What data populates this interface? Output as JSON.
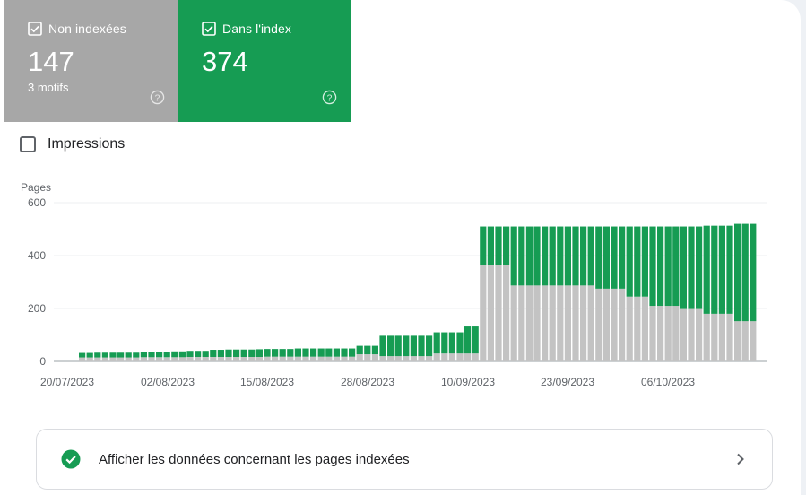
{
  "cards": [
    {
      "label": "Non indexées",
      "value": "147",
      "sub": "3 motifs",
      "color": "#a7a7a7"
    },
    {
      "label": "Dans l'index",
      "value": "374",
      "color": "#169c53"
    }
  ],
  "impressions": {
    "label": "Impressions",
    "checked": false
  },
  "link_row": {
    "label": "Afficher les données concernant les pages indexées"
  },
  "icons": {
    "card_check": "check-box-icon",
    "help": "help-circle-icon",
    "row_status": "check-circle-icon",
    "row_chevron": "chevron-right-icon"
  },
  "colors": {
    "indexed": "#169c53",
    "not_indexed": "#c3c3c3"
  },
  "chart_data": {
    "type": "bar",
    "stacked": true,
    "ylabel": "Pages",
    "ylim": [
      0,
      600
    ],
    "yticks": [
      0,
      200,
      400,
      600
    ],
    "xtick_labels": [
      "20/07/2023",
      "02/08/2023",
      "15/08/2023",
      "28/08/2023",
      "10/09/2023",
      "23/09/2023",
      "06/10/2023"
    ],
    "grid": true,
    "series": [
      {
        "name": "Non indexées",
        "color": "#c3c3c3",
        "values": [
          15,
          15,
          15,
          15,
          15,
          15,
          15,
          15,
          16,
          16,
          16,
          16,
          16,
          16,
          17,
          17,
          17,
          17,
          17,
          17,
          17,
          17,
          17,
          17,
          18,
          18,
          18,
          18,
          18,
          18,
          18,
          18,
          18,
          18,
          18,
          18,
          27,
          27,
          27,
          20,
          20,
          20,
          20,
          20,
          20,
          20,
          30,
          30,
          30,
          30,
          30,
          30,
          365,
          365,
          365,
          365,
          287,
          287,
          287,
          287,
          287,
          287,
          287,
          287,
          287,
          287,
          287,
          275,
          275,
          275,
          275,
          245,
          245,
          245,
          210,
          210,
          210,
          210,
          198,
          198,
          198,
          180,
          180,
          180,
          180,
          152,
          152,
          152
        ]
      },
      {
        "name": "Dans l'index",
        "color": "#169c53",
        "values": [
          17,
          17,
          18,
          18,
          18,
          18,
          18,
          18,
          18,
          18,
          21,
          21,
          22,
          22,
          23,
          23,
          23,
          27,
          27,
          28,
          28,
          28,
          28,
          29,
          29,
          29,
          29,
          29,
          31,
          31,
          31,
          31,
          31,
          31,
          31,
          31,
          32,
          32,
          32,
          77,
          77,
          77,
          77,
          77,
          77,
          77,
          80,
          80,
          80,
          80,
          102,
          102,
          145,
          145,
          145,
          145,
          223,
          223,
          223,
          223,
          223,
          223,
          223,
          223,
          223,
          223,
          223,
          235,
          235,
          235,
          235,
          265,
          265,
          265,
          300,
          300,
          300,
          300,
          312,
          312,
          312,
          333,
          333,
          333,
          333,
          368,
          368,
          368
        ]
      }
    ]
  }
}
